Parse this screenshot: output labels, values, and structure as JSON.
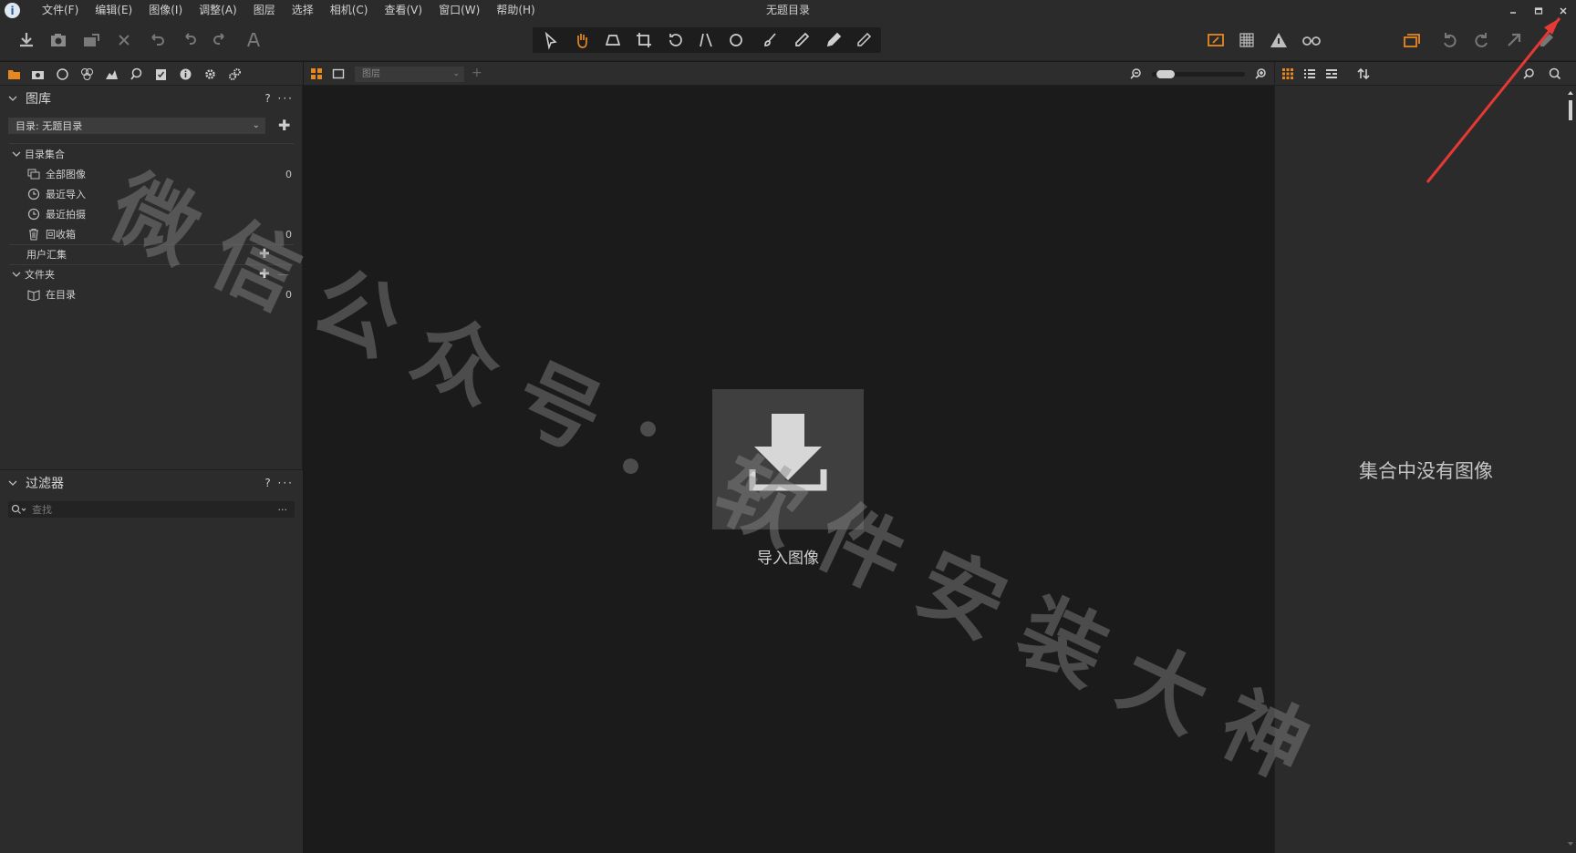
{
  "window": {
    "title": "无题目录"
  },
  "menu": [
    "文件(F)",
    "编辑(E)",
    "图像(I)",
    "调整(A)",
    "图层",
    "选择",
    "相机(C)",
    "查看(V)",
    "窗口(W)",
    "帮助(H)"
  ],
  "library": {
    "title": "图库",
    "actions": "? ···",
    "catalog_label": "目录: 无题目录",
    "catalog_collections": "目录集合",
    "items": [
      {
        "label": "全部图像",
        "count": "0",
        "icon": "all-images-icon"
      },
      {
        "label": "最近导入",
        "count": "",
        "icon": "clock-icon"
      },
      {
        "label": "最近拍摄",
        "count": "",
        "icon": "clock-icon"
      },
      {
        "label": "回收箱",
        "count": "0",
        "icon": "trash-icon"
      }
    ],
    "user_collections": "用户汇集",
    "folders": "文件夹",
    "in_catalog": "在目录",
    "in_catalog_count": "0"
  },
  "filters": {
    "title": "过滤器",
    "actions": "? ···",
    "search_placeholder": "查找",
    "search_more": "···"
  },
  "viewer": {
    "layer_select": "图层",
    "import_label": "导入图像"
  },
  "browser": {
    "empty_message": "集合中没有图像"
  },
  "watermark": "微信公众号：软件安装大神",
  "colors": {
    "accent": "#e8871e",
    "annotation_arrow": "#e53935"
  }
}
